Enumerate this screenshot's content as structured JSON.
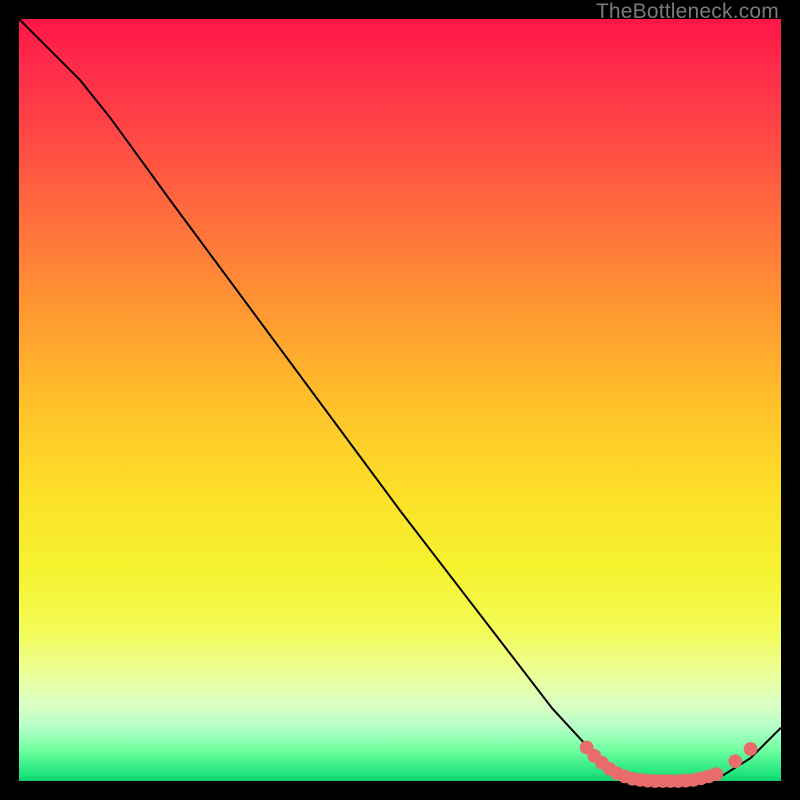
{
  "watermark": "TheBottleneck.com",
  "chart_data": {
    "type": "line",
    "title": "",
    "xlabel": "",
    "ylabel": "",
    "xlim": [
      0,
      100
    ],
    "ylim": [
      0,
      100
    ],
    "series": [
      {
        "name": "curve",
        "x": [
          0,
          8,
          12,
          20,
          30,
          40,
          50,
          60,
          70,
          76,
          80,
          84,
          88,
          92,
          96,
          100
        ],
        "values": [
          100,
          92,
          87,
          76,
          62.5,
          49,
          35.5,
          22.5,
          9.5,
          3,
          0.5,
          0,
          0,
          0.5,
          3,
          7
        ]
      }
    ],
    "markers": [
      {
        "x": 74.5,
        "y": 4.4
      },
      {
        "x": 75.5,
        "y": 3.3
      },
      {
        "x": 76.5,
        "y": 2.4
      },
      {
        "x": 77.5,
        "y": 1.6
      },
      {
        "x": 78.5,
        "y": 1.0
      },
      {
        "x": 79.5,
        "y": 0.6
      },
      {
        "x": 80.5,
        "y": 0.3
      },
      {
        "x": 81.5,
        "y": 0.15
      },
      {
        "x": 82.5,
        "y": 0.05
      },
      {
        "x": 83.5,
        "y": 0.0
      },
      {
        "x": 84.5,
        "y": 0.0
      },
      {
        "x": 85.5,
        "y": 0.0
      },
      {
        "x": 86.5,
        "y": 0.0
      },
      {
        "x": 87.5,
        "y": 0.05
      },
      {
        "x": 88.5,
        "y": 0.15
      },
      {
        "x": 89.5,
        "y": 0.35
      },
      {
        "x": 90.5,
        "y": 0.6
      },
      {
        "x": 91.5,
        "y": 0.9
      },
      {
        "x": 94.0,
        "y": 2.6
      },
      {
        "x": 96.0,
        "y": 4.2
      }
    ],
    "colors": {
      "line": "#000000",
      "marker": "#e86c6c"
    }
  }
}
